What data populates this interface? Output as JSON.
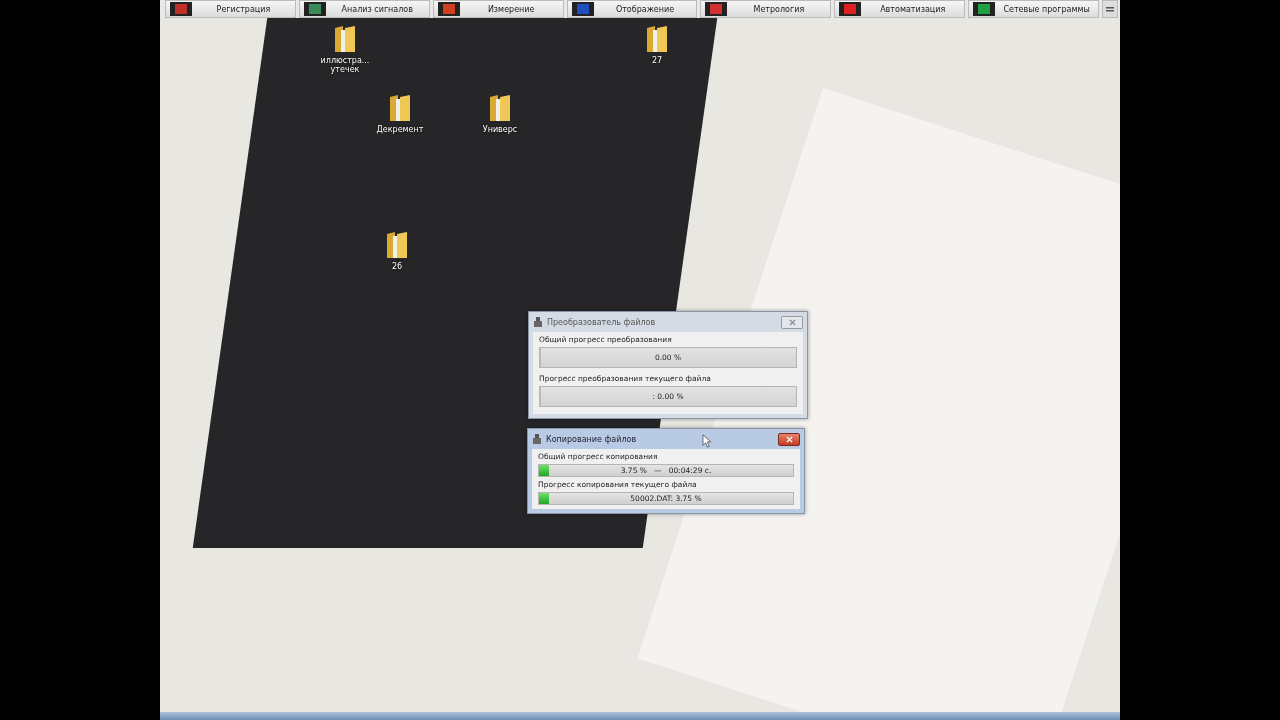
{
  "toolbar": {
    "buttons": [
      {
        "label": "Регистрация",
        "color": "#c0302a"
      },
      {
        "label": "Анализ сигналов",
        "color": "#3a8a5a"
      },
      {
        "label": "Измерение",
        "color": "#d04020"
      },
      {
        "label": "Отображение",
        "color": "#2050c0"
      },
      {
        "label": "Метрология",
        "color": "#d03030"
      },
      {
        "label": "Автоматизация",
        "color": "#e02020"
      },
      {
        "label": "Сетевые программы",
        "color": "#20a040"
      }
    ]
  },
  "desktop_icons": [
    {
      "label": "иллюстра... утечек"
    },
    {
      "label": "27"
    },
    {
      "label": "Декремент"
    },
    {
      "label": "Универс"
    },
    {
      "label": "26"
    }
  ],
  "dialogs": [
    {
      "title": "Преобразователь файлов",
      "active": false,
      "sections": [
        {
          "label": "Общий прогресс преобразования",
          "text": "0.00 %",
          "level": 0
        },
        {
          "label": "Прогресс преобразования текущего файла",
          "text": ": 0.00 %",
          "level": 0
        }
      ]
    },
    {
      "title": "Копирование файлов",
      "active": true,
      "sections": [
        {
          "label": "Общий прогресс копирования",
          "text": "3.75 %   —   00:04:29 с.",
          "level": 0.0375
        },
        {
          "label": "Прогресс копирования текущего файла",
          "text": "50002.DAT: 3.75 %",
          "level": 0.0375
        }
      ]
    }
  ]
}
